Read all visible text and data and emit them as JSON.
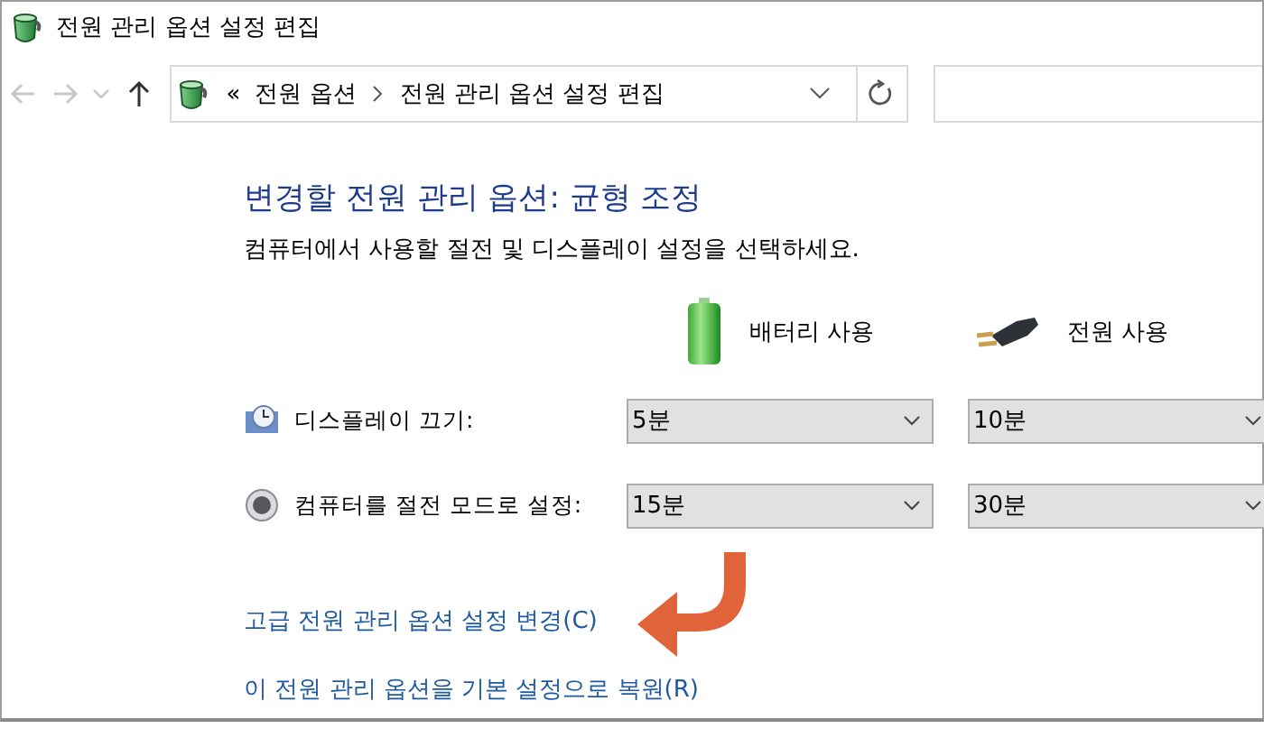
{
  "window": {
    "title": "전원 관리 옵션 설정 편집"
  },
  "nav": [
    {
      "kind": "back",
      "disabled": true
    },
    {
      "kind": "forward",
      "disabled": true
    },
    {
      "kind": "recent",
      "disabled": true
    },
    {
      "kind": "up",
      "disabled": false
    }
  ],
  "address_bar": {
    "overflow": "«",
    "path": [
      "전원 옵션",
      "전원 관리 옵션 설정 편집"
    ]
  },
  "heading": "변경할 전원 관리 옵션: 균형 조정",
  "subtitle": "컴퓨터에서 사용할 절전 및 디스플레이 설정을 선택하세요.",
  "columns": [
    {
      "label": "배터리 사용",
      "kind": "battery"
    },
    {
      "label": "전원 사용",
      "kind": "plug"
    }
  ],
  "settings": [
    {
      "label": "디스플레이 끄기:",
      "kind": "display",
      "values": [
        "5분",
        "10분"
      ]
    },
    {
      "label": "컴퓨터를 절전 모드로 설정:",
      "kind": "sleep",
      "values": [
        "15분",
        "30분"
      ]
    }
  ],
  "links": [
    "고급 전원 관리 옵션 설정 변경(C)",
    "이 전원 관리 옵션을 기본 설정으로 복원(R)"
  ]
}
